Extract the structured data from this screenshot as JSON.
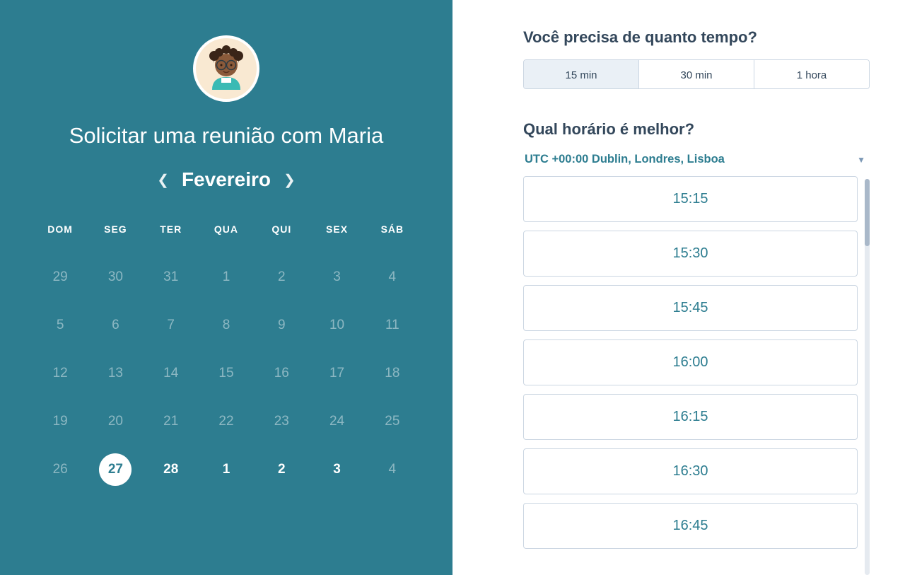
{
  "left": {
    "title": "Solicitar uma reunião com Maria",
    "month_label": "Fevereiro",
    "weekdays": [
      "DOM",
      "SEG",
      "TER",
      "QUA",
      "QUI",
      "SEX",
      "SÁB"
    ],
    "weeks": [
      [
        {
          "d": "29",
          "m": "dim"
        },
        {
          "d": "30",
          "m": "dim"
        },
        {
          "d": "31",
          "m": "dim"
        },
        {
          "d": "1",
          "m": "dim"
        },
        {
          "d": "2",
          "m": "dim"
        },
        {
          "d": "3",
          "m": "dim"
        },
        {
          "d": "4",
          "m": "dim"
        }
      ],
      [
        {
          "d": "5",
          "m": "dim"
        },
        {
          "d": "6",
          "m": "dim"
        },
        {
          "d": "7",
          "m": "dim"
        },
        {
          "d": "8",
          "m": "dim"
        },
        {
          "d": "9",
          "m": "dim"
        },
        {
          "d": "10",
          "m": "dim"
        },
        {
          "d": "11",
          "m": "dim"
        }
      ],
      [
        {
          "d": "12",
          "m": "dim"
        },
        {
          "d": "13",
          "m": "dim"
        },
        {
          "d": "14",
          "m": "dim"
        },
        {
          "d": "15",
          "m": "dim"
        },
        {
          "d": "16",
          "m": "dim"
        },
        {
          "d": "17",
          "m": "dim"
        },
        {
          "d": "18",
          "m": "dim"
        }
      ],
      [
        {
          "d": "19",
          "m": "dim"
        },
        {
          "d": "20",
          "m": "dim"
        },
        {
          "d": "21",
          "m": "dim"
        },
        {
          "d": "22",
          "m": "dim"
        },
        {
          "d": "23",
          "m": "dim"
        },
        {
          "d": "24",
          "m": "dim"
        },
        {
          "d": "25",
          "m": "dim"
        }
      ],
      [
        {
          "d": "26",
          "m": "dim"
        },
        {
          "d": "27",
          "m": "selected"
        },
        {
          "d": "28",
          "m": "active"
        },
        {
          "d": "1",
          "m": "active"
        },
        {
          "d": "2",
          "m": "active"
        },
        {
          "d": "3",
          "m": "active"
        },
        {
          "d": "4",
          "m": "dim"
        }
      ]
    ]
  },
  "right": {
    "duration_heading": "Você precisa de quanto tempo?",
    "durations": [
      {
        "label": "15 min",
        "selected": true
      },
      {
        "label": "30 min",
        "selected": false
      },
      {
        "label": "1 hora",
        "selected": false
      }
    ],
    "time_heading": "Qual horário é melhor?",
    "timezone_label": "UTC +00:00 Dublin, Londres, Lisboa",
    "slots": [
      "15:15",
      "15:30",
      "15:45",
      "16:00",
      "16:15",
      "16:30",
      "16:45"
    ]
  }
}
